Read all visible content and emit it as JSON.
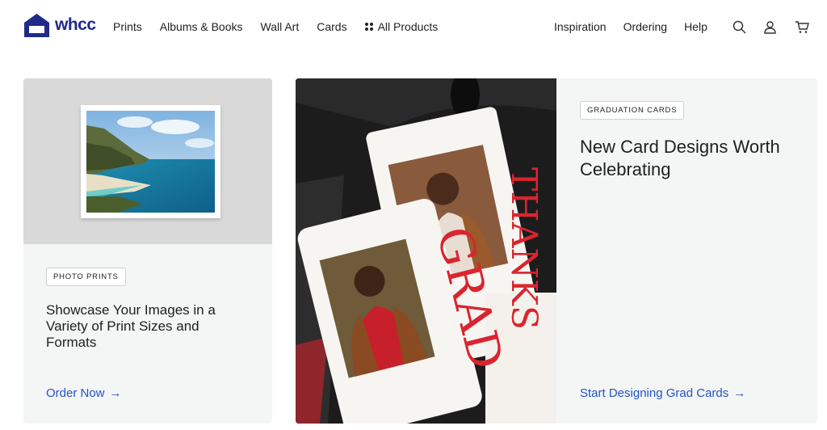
{
  "brand": {
    "name": "whcc",
    "color": "#1f2a8a"
  },
  "nav": {
    "left": [
      "Prints",
      "Albums & Books",
      "Wall Art",
      "Cards"
    ],
    "all_products": "All Products",
    "right": [
      "Inspiration",
      "Ordering",
      "Help"
    ]
  },
  "icons": {
    "search": "search-icon",
    "account": "user-icon",
    "cart": "cart-icon",
    "grid": "grid-icon"
  },
  "cards": {
    "prints": {
      "tag": "PHOTO PRINTS",
      "headline": "Showcase Your Images in a Variety of Print Sizes and Formats",
      "cta": "Order Now",
      "cta_arrow": "→"
    },
    "grad": {
      "tag": "GRADUATION CARDS",
      "headline": "New Card Designs Worth Celebrating",
      "cta": "Start Designing Grad Cards",
      "cta_arrow": "→"
    }
  },
  "colors": {
    "accent": "#2255c4",
    "card_bg": "#f4f5f5",
    "grad_red": "#d9252f"
  }
}
